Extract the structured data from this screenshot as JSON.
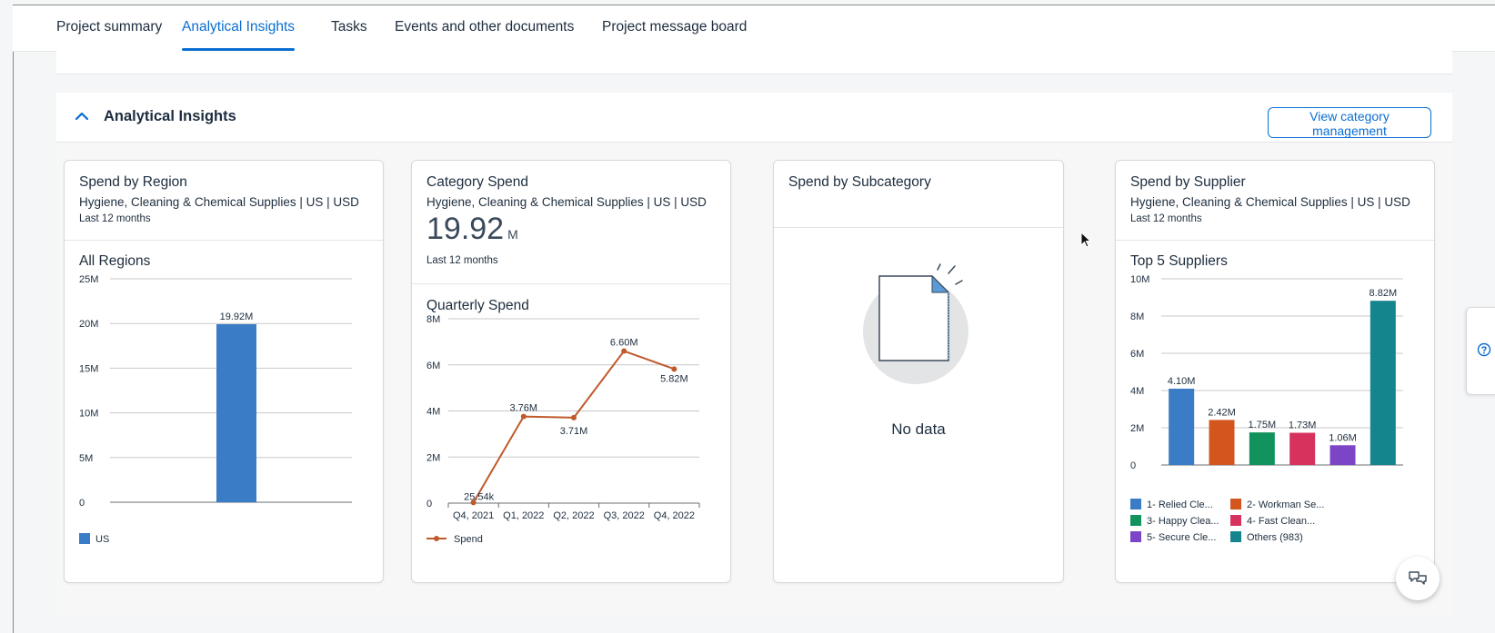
{
  "tabs": [
    {
      "label": "Project summary"
    },
    {
      "label": "Analytical Insights"
    },
    {
      "label": "Tasks"
    },
    {
      "label": "Events and other documents"
    },
    {
      "label": "Project message board"
    }
  ],
  "section": {
    "title": "Analytical Insights",
    "view_button": "View category management"
  },
  "cards": {
    "region": {
      "title": "Spend by Region",
      "subtitle": "Hygiene, Cleaning & Chemical Supplies | US | USD",
      "period": "Last 12 months",
      "chart_title": "All Regions"
    },
    "category": {
      "title": "Category Spend",
      "subtitle": "Hygiene, Cleaning & Chemical Supplies | US | USD",
      "kpi_value": "19.92",
      "kpi_unit": "M",
      "period": "Last 12 months",
      "chart_title": "Quarterly Spend"
    },
    "subcategory": {
      "title": "Spend by Subcategory",
      "no_data": "No data"
    },
    "supplier": {
      "title": "Spend by Supplier",
      "subtitle": "Hygiene, Cleaning & Chemical Supplies | US | USD",
      "period": "Last 12 months",
      "chart_title": "Top 5 Suppliers"
    }
  },
  "colors": {
    "accent": "#0a6ed1",
    "bar_blue": "#3a7cc6",
    "line_orange": "#c0592b"
  },
  "icons": {
    "collapse": "chevron-up-icon",
    "help": "question-circle-icon",
    "feedback": "chat-bubbles-icon",
    "empty": "document-icon"
  },
  "chart_data": [
    {
      "type": "bar",
      "categories": [
        "US"
      ],
      "series": [
        {
          "name": "US",
          "values": [
            19.92
          ],
          "labels": [
            "19.92M"
          ]
        }
      ],
      "yticks": [
        "0",
        "5M",
        "10M",
        "15M",
        "20M",
        "25M"
      ],
      "ylim": [
        0,
        25
      ],
      "grid": true,
      "legend": "bottom-left"
    },
    {
      "type": "line",
      "categories": [
        "Q4, 2021",
        "Q1, 2022",
        "Q2, 2022",
        "Q3, 2022",
        "Q4, 2022"
      ],
      "series": [
        {
          "name": "Spend",
          "values": [
            0.02554,
            3.76,
            3.71,
            6.6,
            5.82
          ],
          "labels": [
            "25.54k",
            "3.76M",
            "3.71M",
            "6.60M",
            "5.82M"
          ]
        }
      ],
      "yticks": [
        "0",
        "2M",
        "4M",
        "6M",
        "8M"
      ],
      "ylim": [
        0,
        8
      ],
      "grid": true,
      "legend": "bottom-left"
    },
    {
      "type": "bar",
      "categories": [
        "1- Relied Cle...",
        "2- Workman Se...",
        "3- Happy Clea...",
        "4- Fast Clean...",
        "5- Secure Cle...",
        "Others (983)"
      ],
      "values": [
        4.1,
        2.42,
        1.75,
        1.73,
        1.06,
        8.82
      ],
      "labels": [
        "4.10M",
        "2.42M",
        "1.75M",
        "1.73M",
        "1.06M",
        "8.82M"
      ],
      "colors": [
        "#3a7cc6",
        "#d4561f",
        "#12925c",
        "#d7325e",
        "#7c45c6",
        "#14858c"
      ],
      "yticks": [
        "0",
        "2M",
        "4M",
        "6M",
        "8M",
        "10M"
      ],
      "ylim": [
        0,
        10
      ],
      "grid": true,
      "legend": "bottom"
    }
  ]
}
